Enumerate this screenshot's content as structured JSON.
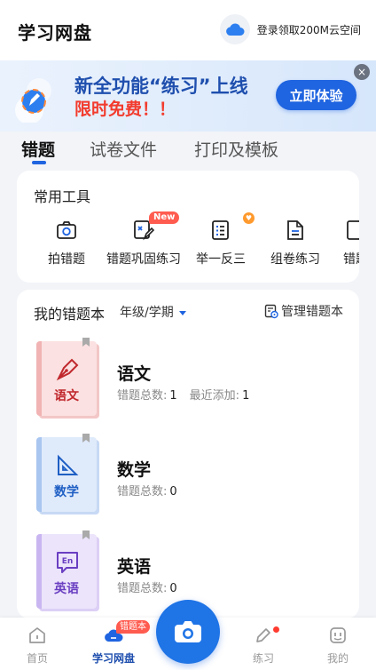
{
  "header": {
    "title": "学习网盘",
    "cloud_promo": "登录领取200M云空间"
  },
  "banner": {
    "line1": "新全功能“练习”上线",
    "line2": "限时免费！！",
    "button": "立即体验",
    "close": "×"
  },
  "tabs": [
    {
      "label": "错题",
      "active": true
    },
    {
      "label": "试卷文件",
      "active": false
    },
    {
      "label": "打印及模板",
      "active": false
    }
  ],
  "tools": {
    "title": "常用工具",
    "items": [
      {
        "label": "拍错题",
        "icon": "camera-icon"
      },
      {
        "label": "错题巩固练习",
        "icon": "practice-icon",
        "badge": "New"
      },
      {
        "label": "举一反三",
        "icon": "list-icon",
        "badge": "heart"
      },
      {
        "label": "组卷练习",
        "icon": "document-icon"
      },
      {
        "label": "错题",
        "icon": "book-icon"
      }
    ]
  },
  "books": {
    "title": "我的错题本",
    "grade_select": "年级/学期",
    "manage": "管理错题本",
    "total_label": "错题总数:",
    "recent_label": "最近添加:",
    "items": [
      {
        "subject": "语文",
        "cover_label": "语文",
        "icon": "pen-nib-icon",
        "total": "1",
        "recent": "1",
        "accent": "#c0282d",
        "cover": "#fbe1e1",
        "spine": "#f1b3b3"
      },
      {
        "subject": "数学",
        "cover_label": "数学",
        "icon": "ruler-triangle-icon",
        "total": "0",
        "accent": "#1f5fc4",
        "cover": "#dfeafb",
        "spine": "#a9c6f0"
      },
      {
        "subject": "英语",
        "cover_label": "英语",
        "icon": "en-chat-icon",
        "total": "0",
        "accent": "#6a3fc2",
        "cover": "#ece4fb",
        "spine": "#c9b6f1"
      }
    ]
  },
  "bottom_nav": {
    "items": [
      {
        "label": "首页",
        "icon": "home-icon"
      },
      {
        "label": "学习网盘",
        "icon": "cloud-icon",
        "active": true,
        "badge": "错题本"
      },
      {
        "label": "练习",
        "icon": "pencil-icon",
        "dot": true
      },
      {
        "label": "我的",
        "icon": "profile-icon"
      }
    ],
    "camera": "camera-icon"
  }
}
